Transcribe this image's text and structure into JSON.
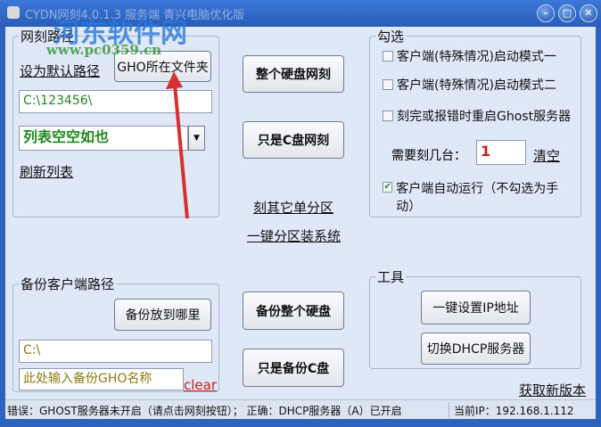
{
  "window": {
    "title": "CYDN网刻4.0.1.3 服务端 青兴电脑优化版",
    "minimize": "–",
    "maximize": "□",
    "close": "✕"
  },
  "watermark": {
    "name": "河东软件网",
    "url": "www.pc0359.cn"
  },
  "net_path": {
    "legend": "网刻路径",
    "set_default": "设为默认路径",
    "gho_folder": "GHO所在文件夹",
    "path_value": "C:\\123456\\",
    "list_value": "列表空空如也",
    "refresh": "刷新列表"
  },
  "center": {
    "whole_disk_net": "整个硬盘网刻",
    "c_only_net": "只是C盘网刻",
    "other_partition": "刻其它单分区",
    "one_key_partition": "一键分区装系统",
    "backup_whole": "备份整个硬盘",
    "backup_c": "只是备份C盘"
  },
  "backup": {
    "legend": "备份客户端路径",
    "where": "备份放到哪里",
    "path_value": "C:\\",
    "name_placeholder": "此处输入备份GHO名称",
    "clear": "clear"
  },
  "options": {
    "legend": "勾选",
    "mode1": "客户端(特殊情况)启动模式一",
    "mode2": "客户端(特殊情况)启动模式二",
    "restart": "刻完或报错时重启Ghost服务器",
    "count_label": "需要刻几台：",
    "count_value": "1",
    "clear": "清空",
    "autorun": "客户端自动运行（不勾选为手动）",
    "mode1_checked": false,
    "mode2_checked": false,
    "restart_checked": false,
    "autorun_checked": true
  },
  "tools": {
    "legend": "工具",
    "set_ip": "一键设置IP地址",
    "switch_dhcp": "切换DHCP服务器"
  },
  "update_link": "获取新版本",
  "status": {
    "message": "错误：GHOST服务器未开启（请点击网刻按钮）； 正确：DHCP服务器（A）已开启",
    "ip": "当前IP：192.168.1.112"
  },
  "colors": {
    "green_text": "#1f8a1f",
    "red": "#d01818",
    "olive": "#8a7a10"
  }
}
